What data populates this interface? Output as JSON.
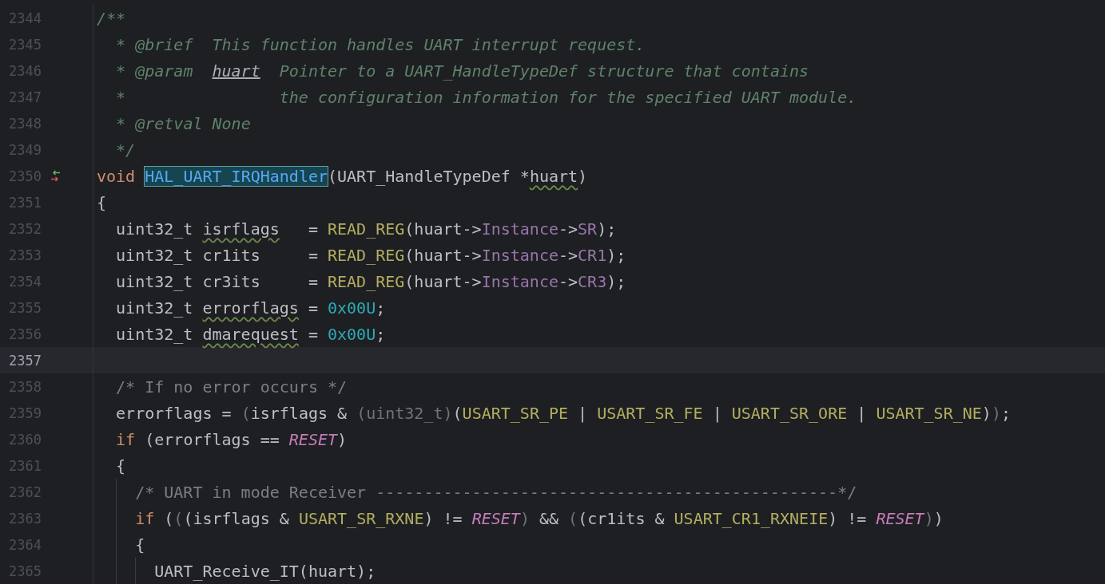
{
  "editor": {
    "lines": [
      {
        "number": "2344",
        "current": false,
        "gutter_icon": false,
        "tokens": [
          {
            "kind": "doc",
            "text": "/**"
          }
        ]
      },
      {
        "number": "2345",
        "current": false,
        "gutter_icon": false,
        "tokens": [
          {
            "kind": "doc",
            "text": "  * "
          },
          {
            "kind": "doctag",
            "text": "@brief"
          },
          {
            "kind": "doc",
            "text": "  This function handles UART interrupt request."
          }
        ]
      },
      {
        "number": "2346",
        "current": false,
        "gutter_icon": false,
        "tokens": [
          {
            "kind": "doc",
            "text": "  * "
          },
          {
            "kind": "doctag",
            "text": "@param  "
          },
          {
            "kind": "docparam",
            "text": "huart"
          },
          {
            "kind": "doc",
            "text": "  Pointer to a UART_HandleTypeDef structure that contains"
          }
        ]
      },
      {
        "number": "2347",
        "current": false,
        "gutter_icon": false,
        "tokens": [
          {
            "kind": "doc",
            "text": "  *                the configuration information for the specified UART module."
          }
        ]
      },
      {
        "number": "2348",
        "current": false,
        "gutter_icon": false,
        "tokens": [
          {
            "kind": "doc",
            "text": "  * "
          },
          {
            "kind": "doctag",
            "text": "@retval"
          },
          {
            "kind": "doc",
            "text": " None"
          }
        ]
      },
      {
        "number": "2349",
        "current": false,
        "gutter_icon": false,
        "tokens": [
          {
            "kind": "doc",
            "text": "  */"
          }
        ]
      },
      {
        "number": "2350",
        "current": false,
        "gutter_icon": true,
        "tokens": [
          {
            "kind": "kw",
            "text": "void "
          },
          {
            "kind": "selected",
            "text": "HAL_UART_IRQHandler"
          },
          {
            "kind": "plain",
            "text": "(UART_HandleTypeDef *"
          },
          {
            "kind": "warn",
            "text": "huart"
          },
          {
            "kind": "plain",
            "text": ")"
          }
        ]
      },
      {
        "number": "2351",
        "current": false,
        "gutter_icon": false,
        "tokens": [
          {
            "kind": "plain",
            "text": "{"
          }
        ]
      },
      {
        "number": "2352",
        "current": false,
        "gutter_icon": false,
        "tokens": [
          {
            "kind": "plain",
            "text": "  uint32_t "
          },
          {
            "kind": "warn",
            "text": "isrflags"
          },
          {
            "kind": "plain",
            "text": "   = "
          },
          {
            "kind": "macro",
            "text": "READ_REG"
          },
          {
            "kind": "plain",
            "text": "(huart->"
          },
          {
            "kind": "field",
            "text": "Instance"
          },
          {
            "kind": "plain",
            "text": "->"
          },
          {
            "kind": "field",
            "text": "SR"
          },
          {
            "kind": "plain",
            "text": ");"
          }
        ]
      },
      {
        "number": "2353",
        "current": false,
        "gutter_icon": false,
        "tokens": [
          {
            "kind": "plain",
            "text": "  uint32_t cr1its     = "
          },
          {
            "kind": "macro",
            "text": "READ_REG"
          },
          {
            "kind": "plain",
            "text": "(huart->"
          },
          {
            "kind": "field",
            "text": "Instance"
          },
          {
            "kind": "plain",
            "text": "->"
          },
          {
            "kind": "field",
            "text": "CR1"
          },
          {
            "kind": "plain",
            "text": ");"
          }
        ]
      },
      {
        "number": "2354",
        "current": false,
        "gutter_icon": false,
        "tokens": [
          {
            "kind": "plain",
            "text": "  uint32_t cr3its     = "
          },
          {
            "kind": "macro",
            "text": "READ_REG"
          },
          {
            "kind": "plain",
            "text": "(huart->"
          },
          {
            "kind": "field",
            "text": "Instance"
          },
          {
            "kind": "plain",
            "text": "->"
          },
          {
            "kind": "field",
            "text": "CR3"
          },
          {
            "kind": "plain",
            "text": ");"
          }
        ]
      },
      {
        "number": "2355",
        "current": false,
        "gutter_icon": false,
        "tokens": [
          {
            "kind": "plain",
            "text": "  uint32_t "
          },
          {
            "kind": "warn",
            "text": "errorflags"
          },
          {
            "kind": "plain",
            "text": " = "
          },
          {
            "kind": "num",
            "text": "0x00U"
          },
          {
            "kind": "plain",
            "text": ";"
          }
        ]
      },
      {
        "number": "2356",
        "current": false,
        "gutter_icon": false,
        "tokens": [
          {
            "kind": "plain",
            "text": "  uint32_t "
          },
          {
            "kind": "warn",
            "text": "dmarequest"
          },
          {
            "kind": "plain",
            "text": " = "
          },
          {
            "kind": "num",
            "text": "0x00U"
          },
          {
            "kind": "plain",
            "text": ";"
          }
        ]
      },
      {
        "number": "2357",
        "current": true,
        "gutter_icon": false
      },
      {
        "number": "2358",
        "current": false,
        "gutter_icon": false,
        "tokens": [
          {
            "kind": "comment",
            "text": "  /* If no error occurs */"
          }
        ]
      },
      {
        "number": "2359",
        "current": false,
        "gutter_icon": false,
        "tokens": [
          {
            "kind": "plain",
            "text": "  errorflags = "
          },
          {
            "kind": "dim",
            "text": "("
          },
          {
            "kind": "plain",
            "text": "isrflags & "
          },
          {
            "kind": "dim",
            "text": "(uint32_t)"
          },
          {
            "kind": "plain",
            "text": "("
          },
          {
            "kind": "macro",
            "text": "USART_SR_PE"
          },
          {
            "kind": "plain",
            "text": " | "
          },
          {
            "kind": "macro",
            "text": "USART_SR_FE"
          },
          {
            "kind": "plain",
            "text": " | "
          },
          {
            "kind": "macro",
            "text": "USART_SR_ORE"
          },
          {
            "kind": "plain",
            "text": " | "
          },
          {
            "kind": "macro",
            "text": "USART_SR_NE"
          },
          {
            "kind": "plain",
            "text": ")"
          },
          {
            "kind": "dim",
            "text": ")"
          },
          {
            "kind": "plain",
            "text": ";"
          }
        ]
      },
      {
        "number": "2360",
        "current": false,
        "gutter_icon": false,
        "tokens": [
          {
            "kind": "kw",
            "text": "  if"
          },
          {
            "kind": "plain",
            "text": " (errorflags == "
          },
          {
            "kind": "const",
            "text": "RESET"
          },
          {
            "kind": "plain",
            "text": ")"
          }
        ]
      },
      {
        "number": "2361",
        "current": false,
        "gutter_icon": false,
        "tokens": [
          {
            "kind": "plain",
            "text": "  {"
          }
        ]
      },
      {
        "number": "2362",
        "current": false,
        "gutter_icon": false,
        "tokens": [
          {
            "kind": "comment",
            "text": "    /* UART in mode Receiver ------------------------------------------------*/"
          }
        ]
      },
      {
        "number": "2363",
        "current": false,
        "gutter_icon": false,
        "tokens": [
          {
            "kind": "kw",
            "text": "    if"
          },
          {
            "kind": "plain",
            "text": " ("
          },
          {
            "kind": "dim",
            "text": "("
          },
          {
            "kind": "plain",
            "text": "(isrflags & "
          },
          {
            "kind": "macro",
            "text": "USART_SR_RXNE"
          },
          {
            "kind": "plain",
            "text": ") != "
          },
          {
            "kind": "const",
            "text": "RESET"
          },
          {
            "kind": "dim",
            "text": ")"
          },
          {
            "kind": "plain",
            "text": " && "
          },
          {
            "kind": "dim",
            "text": "("
          },
          {
            "kind": "plain",
            "text": "(cr1its & "
          },
          {
            "kind": "macro",
            "text": "USART_CR1_RXNEIE"
          },
          {
            "kind": "plain",
            "text": ") != "
          },
          {
            "kind": "const",
            "text": "RESET"
          },
          {
            "kind": "dim",
            "text": ")"
          },
          {
            "kind": "plain",
            "text": ")"
          }
        ]
      },
      {
        "number": "2364",
        "current": false,
        "gutter_icon": false,
        "tokens": [
          {
            "kind": "plain",
            "text": "    {"
          }
        ]
      },
      {
        "number": "2365",
        "current": false,
        "gutter_icon": false,
        "tokens": [
          {
            "kind": "plain",
            "text": "      UART_Receive_IT(huart);"
          }
        ]
      }
    ]
  }
}
